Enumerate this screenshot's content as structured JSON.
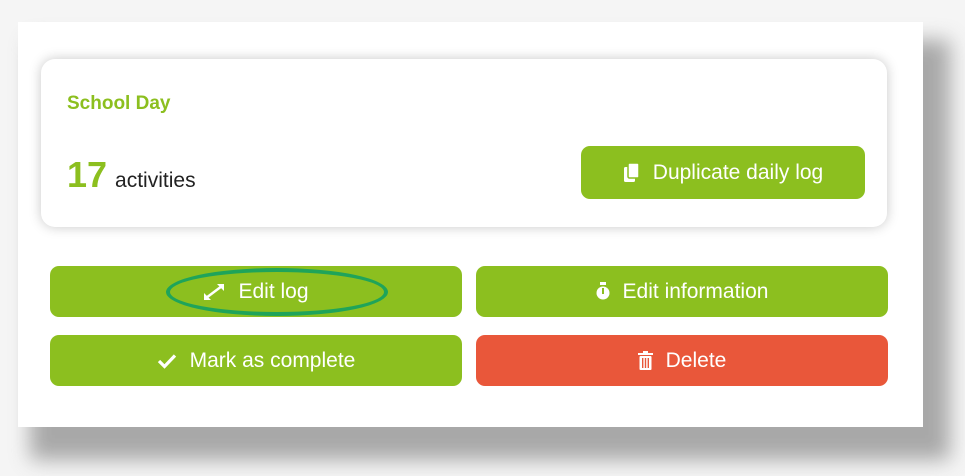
{
  "card": {
    "title": "School Day",
    "count": "17",
    "count_label": "activities",
    "duplicate_label": "Duplicate daily log"
  },
  "actions": {
    "edit_log": "Edit log",
    "edit_information": "Edit information",
    "mark_complete": "Mark as complete",
    "delete": "Delete"
  },
  "icons": {
    "duplicate": "copy-icon",
    "edit_log": "expand-arrows-icon",
    "edit_information": "stopwatch-icon",
    "mark_complete": "checkmark-icon",
    "delete": "trash-icon"
  },
  "colors": {
    "brand_green": "#8cbf1f",
    "danger_red": "#e9573a",
    "highlight_ring": "#1fa45a"
  }
}
